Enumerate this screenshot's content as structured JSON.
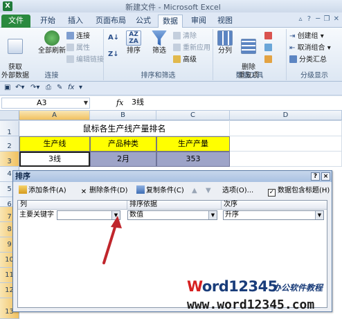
{
  "window": {
    "title": "新建文件 - Microsoft Excel",
    "logo": "X"
  },
  "tabs": [
    {
      "label": "文件"
    },
    {
      "label": "开始"
    },
    {
      "label": "插入"
    },
    {
      "label": "页面布局"
    },
    {
      "label": "公式"
    },
    {
      "label": "数据"
    },
    {
      "label": "审阅"
    },
    {
      "label": "视图"
    }
  ],
  "active_tab": "数据",
  "ribbon": {
    "get_external": "获取\n外部数据",
    "refresh_all": "全部刷新",
    "connections": "连接",
    "properties": "属性",
    "edit_links": "编辑链接",
    "group_connections": "连接",
    "sort": "排序",
    "filter": "筛选",
    "clear": "清除",
    "reapply": "重新应用",
    "advanced": "高级",
    "group_sortfilter": "排序和筛选",
    "text_to_columns": "分列",
    "remove_duplicates": "删除\n重复项",
    "group_datatools": "数据工具",
    "group_btn": "创建组",
    "ungroup_btn": "取消组合",
    "subtotal": "分类汇总",
    "group_outline": "分级显示"
  },
  "formula_bar": {
    "name_box": "A3",
    "fx": "fx",
    "content": "3线"
  },
  "columns": [
    "A",
    "B",
    "C",
    "D"
  ],
  "rows": [
    "1",
    "2",
    "3",
    "4",
    "5",
    "6",
    "7",
    "8",
    "9",
    "10",
    "11",
    "12",
    "13"
  ],
  "sheet": {
    "title": "鼠标各生产线产量排名",
    "headers": [
      "生产线",
      "产品种类",
      "生产产量"
    ],
    "row3": [
      "3线",
      "2月",
      "353"
    ]
  },
  "dialog": {
    "title": "排序",
    "help": "?",
    "close": "×",
    "add_level": "添加条件(A)",
    "delete_level": "删除条件(D)",
    "copy_level": "复制条件(C)",
    "options": "选项(O)...",
    "has_headers": "数据包含标题(H)",
    "col_header": "列",
    "sorton_header": "排序依据",
    "order_header": "次序",
    "row_label": "主要关键字",
    "key_value": "",
    "sorton_value": "数值",
    "order_value": "升序"
  },
  "watermark": {
    "brand_w": "W",
    "brand_rest": "ord12345",
    "sub": "办公软件教程",
    "url": "www.word12345.com"
  },
  "colors": {
    "file_tab": "#2a8a3e",
    "yellow_header": "#ffff00",
    "purple_cells": "#9ea4c8",
    "arrow": "#c0262c"
  }
}
